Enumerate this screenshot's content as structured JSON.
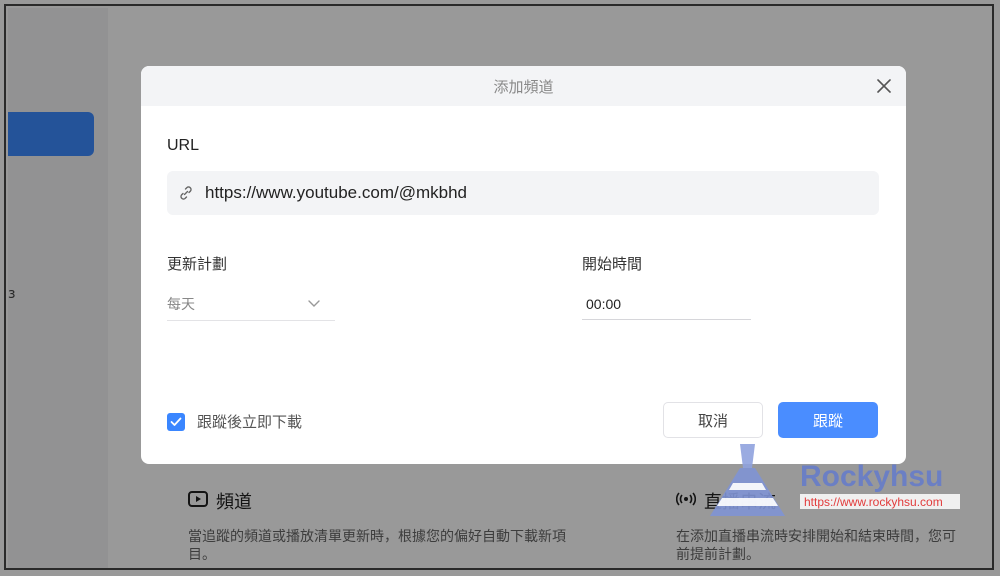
{
  "dialog": {
    "title": "添加頻道",
    "url_label": "URL",
    "url_value": "https://www.youtube.com/@mkbhd",
    "schedule_label": "更新計劃",
    "schedule_value": "每天",
    "start_time_label": "開始時間",
    "start_time_value": "00:00",
    "download_checkbox_label": "跟蹤後立即下載",
    "download_checked": true,
    "cancel_label": "取消",
    "follow_label": "跟蹤"
  },
  "background": {
    "feature_channel": {
      "title": "頻道",
      "desc_line1": "當追蹤的頻道或播放清單更新時，根據您的偏好自動下載新項",
      "desc_line2": "目。"
    },
    "feature_live": {
      "title": "直播串流",
      "desc_line1": "在添加直播串流時安排開始和結束時間，您可",
      "desc_line2": "前提前計劃。"
    }
  },
  "watermark": {
    "brand": "Rockyhsu",
    "url": "https://www.rockyhsu.com"
  },
  "colors": {
    "accent": "#4a8dff",
    "checkbox": "#3a86ff",
    "overlay": "rgba(0,0,0,0.40)",
    "watermark_brand": "#6b7fc4",
    "watermark_url": "#e23b3b"
  },
  "icons": {
    "close": "close-icon",
    "link": "link-icon",
    "chevron": "chevron-down-icon",
    "check": "check-icon",
    "play": "play-box-icon",
    "broadcast": "broadcast-icon"
  }
}
